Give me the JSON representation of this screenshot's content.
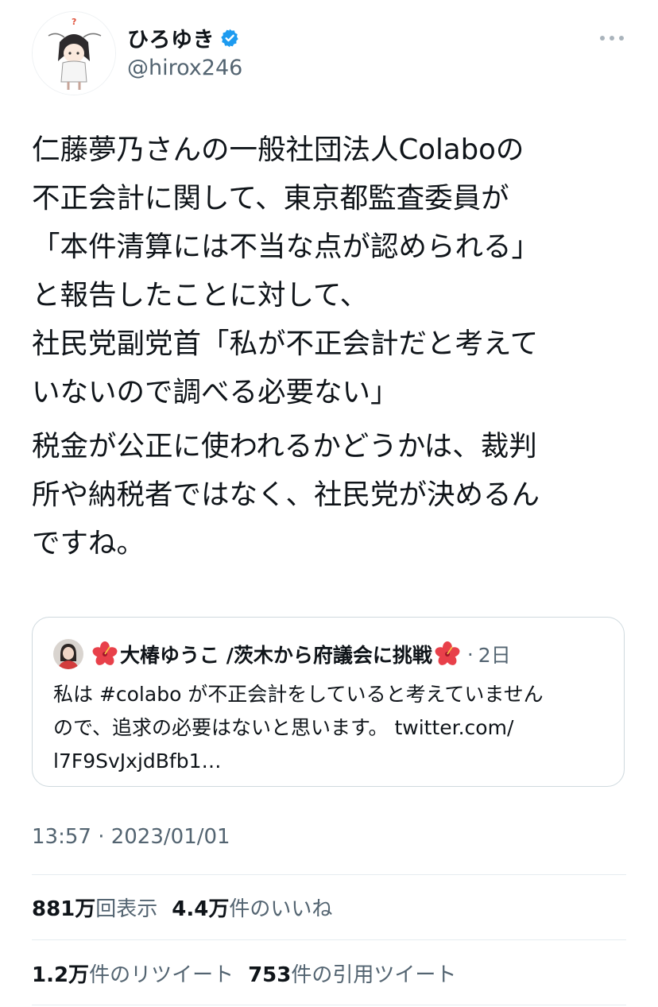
{
  "author": {
    "display_name": "ひろゆき",
    "handle": "@hirox246",
    "verified": true,
    "badge_color": "#1d9bf0"
  },
  "tweet": {
    "paragraphs": [
      {
        "lines": [
          "仁藤夢乃さんの一般社団法人Colaboの",
          "不正会計に関して、東京都監査委員が",
          "「本件清算には不当な点が認められる」",
          "と報告したことに対して、",
          "社民党副党首「私が不正会計だと考えて",
          "いないので調べる必要ない」"
        ]
      },
      {
        "lines": [
          "税金が公正に使われるかどうかは、裁判",
          "所や納税者ではなく、社民党が決めるん",
          "ですね。"
        ]
      }
    ]
  },
  "quote": {
    "author_name": "大椿ゆうこ /茨木から府議会に挑戦",
    "emoji_icon": "hibiscus-icon",
    "separator": "·",
    "time": "2日",
    "lines": [
      "私は #colabo が不正会計をしていると考えていません",
      "ので、追求の必要はないと思います。 twitter.com/",
      "l7F9SvJxjdBfb1…"
    ]
  },
  "timestamp": "13:57 · 2023/01/01",
  "stats": {
    "views_count": "881万",
    "views_label": "回表示",
    "likes_count": "4.4万",
    "likes_label": "件のいいね",
    "retweets_count": "1.2万",
    "retweets_label": "件のリツイート",
    "quotes_count": "753",
    "quotes_label": "件の引用ツイート"
  }
}
